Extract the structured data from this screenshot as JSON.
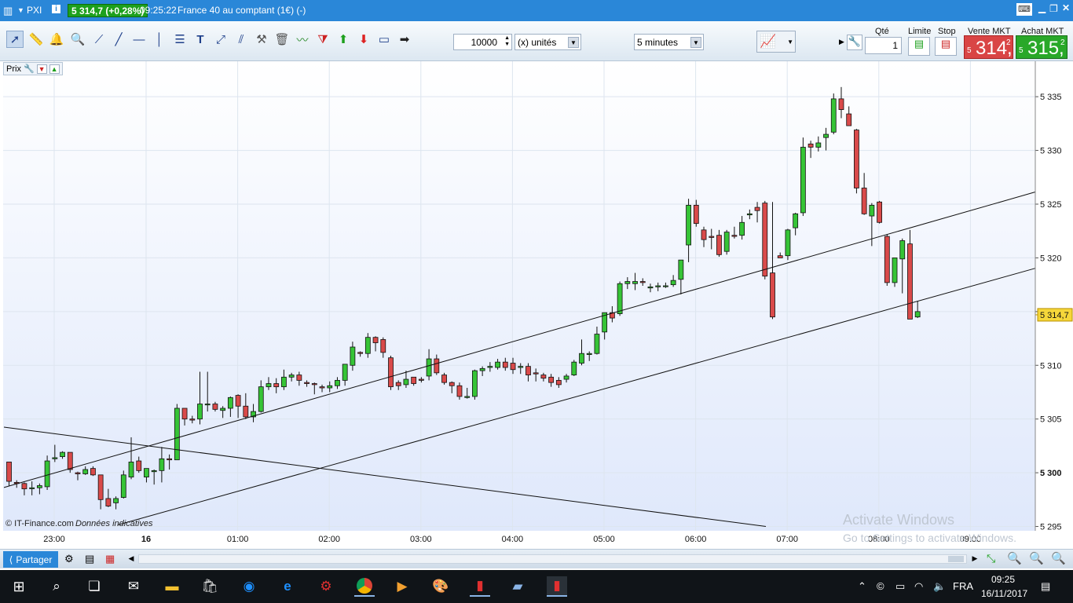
{
  "titlebar": {
    "symbol": "PXI",
    "price_badge": "5 314,7 (+0,28%)",
    "time": "09:25:22",
    "instrument": "France 40 au comptant (1€) (-)",
    "window_controls": [
      "keyboard-icon",
      "minimize-icon",
      "restore-icon",
      "close-icon"
    ]
  },
  "toolbar": {
    "tools": [
      "cursor-icon",
      "ruler-icon",
      "alert-bell-icon",
      "zoom-icon",
      "segment-icon",
      "line-icon",
      "horizontal-line-icon",
      "vertical-line-icon",
      "fibonacci-icon",
      "text-icon",
      "arrow-line-icon",
      "channel-icon",
      "hammer-icon",
      "trash-icon",
      "trend-icon",
      "triangle-icon",
      "buy-arrow-icon",
      "sell-arrow-icon",
      "rectangle-icon",
      "arrow-right-icon"
    ],
    "quantity": "10000",
    "units": "(x) unités",
    "timeframe": "5 minutes"
  },
  "order": {
    "qty_label": "Qté",
    "qty_value": "1",
    "limit_label": "Limite",
    "stop_label": "Stop",
    "sell_label": "Vente MKT",
    "buy_label": "Achat MKT",
    "sell_prefix": "5",
    "sell_price": "314,",
    "sell_sup": "2",
    "buy_prefix": "5",
    "buy_price": "315,",
    "buy_sup": "2"
  },
  "panel": {
    "prix_label": "Prix"
  },
  "chart_data": {
    "type": "candlestick",
    "y_ticks": [
      "5 335",
      "5 330",
      "5 325",
      "5 320",
      "5 315",
      "5 310",
      "5 305",
      "5 300",
      "5 295"
    ],
    "y_values": [
      5335,
      5330,
      5325,
      5320,
      5315,
      5310,
      5305,
      5300,
      5295
    ],
    "x_ticks": [
      "23:00",
      "16",
      "01:00",
      "02:00",
      "03:00",
      "04:00",
      "05:00",
      "06:00",
      "07:00",
      "08:00",
      "09:00"
    ],
    "ylim": [
      5294.6,
      5338.3
    ],
    "current_price_label": "5 314,7",
    "current_price": 5314.7,
    "copyright": "© IT-Finance.com",
    "disclaimer": "Données indicatives",
    "watermark_title": "Activate Windows",
    "watermark_sub": "Go to Settings to activate Windows.",
    "colors": {
      "up": "#36c436",
      "down": "#d94a4a",
      "grid": "#dde5ef"
    },
    "candles": [
      [
        5301.0,
        5301.0,
        5298.8,
        5299.2
      ],
      [
        5299.1,
        5299.3,
        5298.6,
        5299.0
      ],
      [
        5299.0,
        5299.1,
        5297.9,
        5298.5
      ],
      [
        5298.6,
        5299.2,
        5297.9,
        5298.6
      ],
      [
        5298.6,
        5299.0,
        5298.0,
        5298.8
      ],
      [
        5298.7,
        5301.6,
        5298.4,
        5301.1
      ],
      [
        5301.3,
        5302.6,
        5301.0,
        5301.4
      ],
      [
        5301.5,
        5302.0,
        5301.3,
        5301.9
      ],
      [
        5301.9,
        5301.9,
        5300.0,
        5300.3
      ],
      [
        5300.0,
        5300.1,
        5299.3,
        5299.9
      ],
      [
        5299.9,
        5300.6,
        5299.8,
        5300.3
      ],
      [
        5300.4,
        5300.6,
        5299.7,
        5299.8
      ],
      [
        5299.8,
        5299.8,
        5296.6,
        5297.5
      ],
      [
        5297.6,
        5298.5,
        5296.8,
        5296.9
      ],
      [
        5297.2,
        5297.8,
        5296.6,
        5297.6
      ],
      [
        5297.7,
        5300.2,
        5297.6,
        5299.8
      ],
      [
        5299.6,
        5303.3,
        5299.4,
        5301.0
      ],
      [
        5301.1,
        5301.5,
        5300.0,
        5300.2
      ],
      [
        5299.6,
        5300.4,
        5299.1,
        5300.4
      ],
      [
        5300.1,
        5300.3,
        5298.9,
        5300.2
      ],
      [
        5300.2,
        5302.4,
        5299.1,
        5301.3
      ],
      [
        5301.3,
        5301.7,
        5300.3,
        5301.2
      ],
      [
        5301.2,
        5306.4,
        5301.2,
        5306.0
      ],
      [
        5306.0,
        5306.0,
        5304.4,
        5305.0
      ],
      [
        5305.0,
        5305.3,
        5304.6,
        5304.9
      ],
      [
        5305.0,
        5309.4,
        5304.5,
        5306.4
      ],
      [
        5306.4,
        5309.4,
        5305.7,
        5306.4
      ],
      [
        5306.4,
        5306.6,
        5305.7,
        5305.9
      ],
      [
        5305.8,
        5306.2,
        5305.1,
        5306.0
      ],
      [
        5306.0,
        5307.1,
        5305.2,
        5307.0
      ],
      [
        5307.2,
        5307.3,
        5305.1,
        5306.2
      ],
      [
        5306.2,
        5307.4,
        5305.0,
        5305.2
      ],
      [
        5305.2,
        5306.4,
        5304.7,
        5305.7
      ],
      [
        5305.7,
        5308.6,
        5305.6,
        5308.0
      ],
      [
        5308.0,
        5308.9,
        5307.7,
        5308.3
      ],
      [
        5308.3,
        5308.8,
        5307.4,
        5308.0
      ],
      [
        5308.0,
        5309.6,
        5307.7,
        5308.9
      ],
      [
        5308.9,
        5309.3,
        5308.5,
        5309.1
      ],
      [
        5309.1,
        5309.4,
        5308.1,
        5308.6
      ],
      [
        5308.4,
        5308.6,
        5308.0,
        5308.3
      ],
      [
        5308.3,
        5308.4,
        5307.3,
        5308.2
      ],
      [
        5308.0,
        5308.2,
        5307.5,
        5307.9
      ],
      [
        5307.9,
        5308.5,
        5307.5,
        5308.1
      ],
      [
        5308.1,
        5308.9,
        5307.8,
        5308.6
      ],
      [
        5308.6,
        5310.1,
        5308.1,
        5310.1
      ],
      [
        5310.0,
        5312.2,
        5309.5,
        5311.7
      ],
      [
        5311.2,
        5311.3,
        5310.8,
        5311.1
      ],
      [
        5311.1,
        5313.0,
        5310.7,
        5312.6
      ],
      [
        5312.6,
        5312.7,
        5311.3,
        5312.1
      ],
      [
        5312.4,
        5312.6,
        5310.7,
        5311.2
      ],
      [
        5310.7,
        5310.9,
        5307.7,
        5308.0
      ],
      [
        5308.4,
        5308.6,
        5307.7,
        5308.1
      ],
      [
        5308.2,
        5309.5,
        5307.9,
        5308.7
      ],
      [
        5308.9,
        5308.9,
        5308.1,
        5308.3
      ],
      [
        5308.7,
        5308.9,
        5308.4,
        5308.6
      ],
      [
        5309.0,
        5311.5,
        5308.6,
        5310.6
      ],
      [
        5310.6,
        5311.0,
        5309.1,
        5309.3
      ],
      [
        5309.1,
        5309.3,
        5308.2,
        5308.4
      ],
      [
        5308.4,
        5308.5,
        5307.4,
        5308.1
      ],
      [
        5308.1,
        5308.4,
        5306.8,
        5307.1
      ],
      [
        5307.0,
        5307.9,
        5306.9,
        5307.1
      ],
      [
        5307.1,
        5309.6,
        5306.8,
        5309.5
      ],
      [
        5309.5,
        5309.9,
        5309.0,
        5309.7
      ],
      [
        5309.8,
        5310.3,
        5309.4,
        5309.9
      ],
      [
        5309.8,
        5310.6,
        5309.6,
        5310.3
      ],
      [
        5310.3,
        5310.7,
        5309.5,
        5309.8
      ],
      [
        5310.2,
        5310.7,
        5309.2,
        5309.6
      ],
      [
        5309.8,
        5310.2,
        5309.2,
        5309.9
      ],
      [
        5309.9,
        5310.2,
        5308.5,
        5309.1
      ],
      [
        5309.3,
        5309.7,
        5308.5,
        5309.2
      ],
      [
        5309.1,
        5309.3,
        5308.5,
        5308.8
      ],
      [
        5308.9,
        5309.2,
        5308.0,
        5308.4
      ],
      [
        5308.6,
        5308.9,
        5307.9,
        5308.2
      ],
      [
        5308.7,
        5309.2,
        5308.4,
        5309.0
      ],
      [
        5309.1,
        5310.5,
        5309.0,
        5310.3
      ],
      [
        5310.2,
        5312.4,
        5310.0,
        5311.1
      ],
      [
        5311.0,
        5311.3,
        5310.4,
        5311.1
      ],
      [
        5311.1,
        5313.6,
        5311.0,
        5312.9
      ],
      [
        5313.1,
        5314.9,
        5312.4,
        5314.9
      ],
      [
        5314.9,
        5315.5,
        5314.0,
        5314.4
      ],
      [
        5314.8,
        5317.8,
        5314.6,
        5317.6
      ],
      [
        5317.6,
        5318.2,
        5317.1,
        5317.8
      ],
      [
        5317.6,
        5318.6,
        5317.0,
        5317.8
      ],
      [
        5317.8,
        5318.1,
        5317.4,
        5317.7
      ],
      [
        5317.2,
        5317.6,
        5316.8,
        5317.3
      ],
      [
        5317.3,
        5317.7,
        5316.9,
        5317.4
      ],
      [
        5317.4,
        5317.7,
        5317.2,
        5317.4
      ],
      [
        5317.5,
        5318.4,
        5317.3,
        5317.9
      ],
      [
        5318.0,
        5319.8,
        5316.6,
        5319.8
      ],
      [
        5321.2,
        5325.5,
        5319.6,
        5324.9
      ],
      [
        5324.9,
        5325.4,
        5322.9,
        5323.2
      ],
      [
        5322.6,
        5322.9,
        5321.0,
        5321.7
      ],
      [
        5322.0,
        5322.7,
        5320.8,
        5321.9
      ],
      [
        5322.1,
        5322.6,
        5320.1,
        5320.3
      ],
      [
        5320.6,
        5322.6,
        5320.3,
        5322.4
      ],
      [
        5322.1,
        5322.9,
        5321.8,
        5322.0
      ],
      [
        5322.1,
        5323.9,
        5321.7,
        5323.3
      ],
      [
        5324.0,
        5324.5,
        5323.6,
        5324.1
      ],
      [
        5324.7,
        5325.2,
        5323.3,
        5324.4
      ],
      [
        5325.1,
        5325.3,
        5318.0,
        5318.3
      ],
      [
        5318.6,
        5325.2,
        5314.3,
        5314.5
      ],
      [
        5320.2,
        5320.5,
        5320.0,
        5320.0
      ],
      [
        5320.2,
        5322.7,
        5319.8,
        5322.6
      ],
      [
        5322.8,
        5324.2,
        5322.1,
        5324.1
      ],
      [
        5324.2,
        5331.2,
        5323.9,
        5330.3
      ],
      [
        5330.6,
        5330.9,
        5329.3,
        5330.3
      ],
      [
        5330.3,
        5331.3,
        5329.9,
        5330.7
      ],
      [
        5331.2,
        5332.1,
        5330.0,
        5331.5
      ],
      [
        5331.7,
        5335.3,
        5331.5,
        5334.8
      ],
      [
        5334.8,
        5335.9,
        5333.0,
        5333.8
      ],
      [
        5333.4,
        5334.1,
        5332.3,
        5332.3
      ],
      [
        5331.9,
        5332.0,
        5326.0,
        5326.5
      ],
      [
        5326.5,
        5327.9,
        5324.0,
        5324.1
      ],
      [
        5323.9,
        5325.1,
        5321.1,
        5324.9
      ],
      [
        5325.2,
        5325.3,
        5323.2,
        5323.3
      ],
      [
        5322.0,
        5322.2,
        5317.4,
        5317.7
      ],
      [
        5317.7,
        5320.0,
        5317.3,
        5320.0
      ],
      [
        5319.9,
        5321.8,
        5316.7,
        5321.6
      ],
      [
        5321.3,
        5322.6,
        5315.1,
        5314.3
      ],
      [
        5314.5,
        5316.0,
        5314.4,
        5315.0
      ]
    ],
    "trendlines": [
      {
        "x0": 5,
        "y0": 5298.63,
        "x1": 1318,
        "y1": 5326.13
      },
      {
        "x0": 5,
        "y0": 5304.25,
        "x1": 975,
        "y1": 5295.0
      },
      {
        "x0": 150,
        "y0": 5295.15,
        "x1": 1318,
        "y1": 5319.03
      }
    ]
  },
  "statusbar": {
    "share_label": "Partager"
  },
  "taskbar": {
    "apps": [
      "start-icon",
      "search-icon",
      "task-view-icon",
      "mail-icon",
      "file-explorer-icon",
      "store-icon",
      "app-blue-icon",
      "edge-icon",
      "app-red-icon",
      "chrome-icon",
      "media-icon",
      "paint-icon",
      "prorealtime-icon",
      "notes-icon",
      "prorealtime-active-icon"
    ],
    "language": "FRA",
    "clock_time": "09:25",
    "clock_date": "16/11/2017"
  }
}
